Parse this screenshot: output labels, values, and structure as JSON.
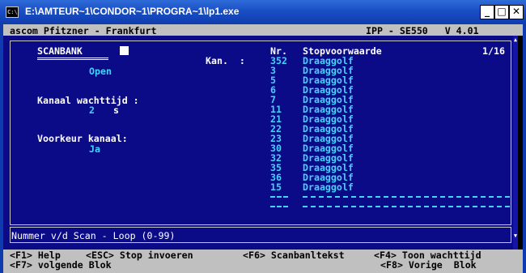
{
  "window": {
    "title": "E:\\AMTEUR~1\\CONDOR~1\\PROGRA~1\\lp1.exe",
    "icon_label": "C:\\",
    "minimize": "_",
    "maximize": "□",
    "close": "✕"
  },
  "header": {
    "left": "ascom Pfitzner - Frankfurt",
    "right": "IPP - SE550   V 4.01"
  },
  "scanbank": {
    "title": "SCANBANK",
    "cursor_char": "",
    "status": "Open",
    "kanaal_label": "Kan.  :",
    "wachttijd_label": "Kanaal wachttijd :",
    "wachttijd_value": "2",
    "wachttijd_unit": "s",
    "voorkeur_label": "Voorkeur kanaal:",
    "voorkeur_value": "Ja"
  },
  "table": {
    "col_nr": "Nr.",
    "col_stop": "Stopvoorwaarde",
    "page": "1/16",
    "rows": [
      {
        "nr": "352",
        "stop": "Draaggolf"
      },
      {
        "nr": "3",
        "stop": "Draaggolf"
      },
      {
        "nr": "5",
        "stop": "Draaggolf"
      },
      {
        "nr": "6",
        "stop": "Draaggolf"
      },
      {
        "nr": "7",
        "stop": "Draaggolf"
      },
      {
        "nr": "11",
        "stop": "Draaggolf"
      },
      {
        "nr": "21",
        "stop": "Draaggolf"
      },
      {
        "nr": "22",
        "stop": "Draaggolf"
      },
      {
        "nr": "23",
        "stop": "Draaggolf"
      },
      {
        "nr": "30",
        "stop": "Draaggolf"
      },
      {
        "nr": "32",
        "stop": "Draaggolf"
      },
      {
        "nr": "35",
        "stop": "Draaggolf"
      },
      {
        "nr": "36",
        "stop": "Draaggolf"
      },
      {
        "nr": "15",
        "stop": "Draaggolf"
      }
    ]
  },
  "statusline": "Nummer v/d Scan - Loop (0-99)",
  "scroll": {
    "up": "▲",
    "down": "▼"
  },
  "keys": {
    "row1": [
      {
        "key": "<F1>",
        "label": "Help"
      },
      {
        "key": "<ESC>",
        "label": "Stop invoeren"
      },
      {
        "key": "<F6>",
        "label": "Scanbanltekst"
      },
      {
        "key": "<F4>",
        "label": "Toon wachttijd"
      }
    ],
    "row2": [
      {
        "key": "<F7>",
        "label": "volgende Blok"
      },
      {
        "key": "<F8>",
        "label": "Vorige  Blok"
      }
    ]
  },
  "colors": {
    "panel": "#0b0b88",
    "cyan_text": "#46d2ff",
    "titlebar": "#1a4fc4",
    "gray_bar": "#c0c0c0"
  }
}
